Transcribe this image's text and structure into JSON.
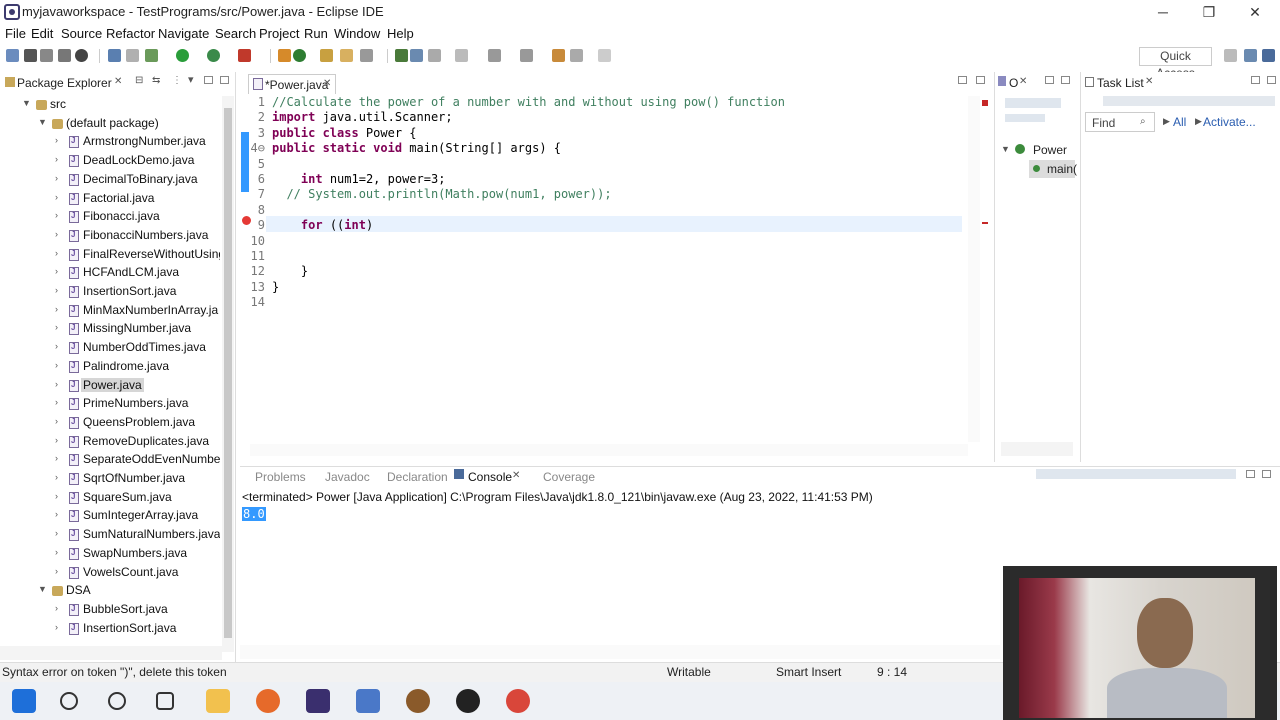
{
  "window": {
    "title": "myjavaworkspace - TestPrograms/src/Power.java - Eclipse IDE",
    "minimize_label": "─",
    "restore_label": "❐",
    "close_label": "✕"
  },
  "menu": [
    "File",
    "Edit",
    "Source",
    "Refactor",
    "Navigate",
    "Search",
    "Project",
    "Run",
    "Window",
    "Help"
  ],
  "toolbar": {
    "quick_access_placeholder": "Quick Access"
  },
  "package_explorer": {
    "title": "Package Explorer",
    "items": [
      {
        "label": "src",
        "kind": "folder",
        "indent": 1,
        "twisty": "▼"
      },
      {
        "label": "(default package)",
        "kind": "package",
        "indent": 2,
        "twisty": "▼"
      },
      {
        "label": "ArmstrongNumber.java",
        "kind": "file",
        "indent": 3,
        "twisty": "›"
      },
      {
        "label": "DeadLockDemo.java",
        "kind": "file",
        "indent": 3,
        "twisty": "›"
      },
      {
        "label": "DecimalToBinary.java",
        "kind": "file",
        "indent": 3,
        "twisty": "›"
      },
      {
        "label": "Factorial.java",
        "kind": "file",
        "indent": 3,
        "twisty": "›"
      },
      {
        "label": "Fibonacci.java",
        "kind": "file",
        "indent": 3,
        "twisty": "›"
      },
      {
        "label": "FibonacciNumbers.java",
        "kind": "file",
        "indent": 3,
        "twisty": "›"
      },
      {
        "label": "FinalReverseWithoutUsing",
        "kind": "file",
        "indent": 3,
        "twisty": "›"
      },
      {
        "label": "HCFAndLCM.java",
        "kind": "file",
        "indent": 3,
        "twisty": "›"
      },
      {
        "label": "InsertionSort.java",
        "kind": "file",
        "indent": 3,
        "twisty": "›"
      },
      {
        "label": "MinMaxNumberInArray.ja",
        "kind": "file",
        "indent": 3,
        "twisty": "›"
      },
      {
        "label": "MissingNumber.java",
        "kind": "file",
        "indent": 3,
        "twisty": "›"
      },
      {
        "label": "NumberOddTimes.java",
        "kind": "file",
        "indent": 3,
        "twisty": "›"
      },
      {
        "label": "Palindrome.java",
        "kind": "file",
        "indent": 3,
        "twisty": "›"
      },
      {
        "label": "Power.java",
        "kind": "file",
        "indent": 3,
        "twisty": "›",
        "selected": true
      },
      {
        "label": "PrimeNumbers.java",
        "kind": "file",
        "indent": 3,
        "twisty": "›"
      },
      {
        "label": "QueensProblem.java",
        "kind": "file",
        "indent": 3,
        "twisty": "›"
      },
      {
        "label": "RemoveDuplicates.java",
        "kind": "file",
        "indent": 3,
        "twisty": "›"
      },
      {
        "label": "SeparateOddEvenNumbe",
        "kind": "file",
        "indent": 3,
        "twisty": "›"
      },
      {
        "label": "SqrtOfNumber.java",
        "kind": "file",
        "indent": 3,
        "twisty": "›"
      },
      {
        "label": "SquareSum.java",
        "kind": "file",
        "indent": 3,
        "twisty": "›"
      },
      {
        "label": "SumIntegerArray.java",
        "kind": "file",
        "indent": 3,
        "twisty": "›"
      },
      {
        "label": "SumNaturalNumbers.java",
        "kind": "file",
        "indent": 3,
        "twisty": "›"
      },
      {
        "label": "SwapNumbers.java",
        "kind": "file",
        "indent": 3,
        "twisty": "›"
      },
      {
        "label": "VowelsCount.java",
        "kind": "file",
        "indent": 3,
        "twisty": "›"
      },
      {
        "label": "DSA",
        "kind": "package",
        "indent": 2,
        "twisty": "▼"
      },
      {
        "label": "BubbleSort.java",
        "kind": "file",
        "indent": 3,
        "twisty": "›"
      },
      {
        "label": "InsertionSort.java",
        "kind": "file",
        "indent": 3,
        "twisty": "›"
      }
    ]
  },
  "editor": {
    "tab_label": "*Power.java",
    "lines": [
      {
        "n": "1",
        "html": "<span class=\"cm\">//Calculate the power of a number with and without using pow() function</span>"
      },
      {
        "n": "2",
        "html": "<span class=\"kw\">import</span> java.util.Scanner;"
      },
      {
        "n": "3",
        "html": "<span class=\"kw\">public class</span> Power {"
      },
      {
        "n": "4⊖",
        "html": "<span class=\"kw\">public static void</span> main(String[] args) {"
      },
      {
        "n": "5",
        "html": ""
      },
      {
        "n": "6",
        "html": "    <span class=\"kw\">int</span> num1=2, power=3;"
      },
      {
        "n": "7",
        "html": "  <span class=\"cm\">// System.out.println(Math.pow(num1, power));</span>"
      },
      {
        "n": "8",
        "html": ""
      },
      {
        "n": "9",
        "html": "    <span class=\"kw\">for</span> ((<span class=\"kw\">int</span>)"
      },
      {
        "n": "10",
        "html": ""
      },
      {
        "n": "11",
        "html": ""
      },
      {
        "n": "12",
        "html": "    }"
      },
      {
        "n": "13",
        "html": "}"
      },
      {
        "n": "14",
        "html": ""
      }
    ]
  },
  "outline": {
    "tab_label": "O",
    "root": "Power",
    "child": "main("
  },
  "task_list": {
    "title": "Task List",
    "find_placeholder": "Find",
    "all_label": "All",
    "activate_label": "Activate..."
  },
  "console": {
    "tabs": [
      "Problems",
      "Javadoc",
      "Declaration",
      "Console",
      "Coverage"
    ],
    "active_tab": "Console",
    "terminated": "<terminated> Power [Java Application] C:\\Program Files\\Java\\jdk1.8.0_121\\bin\\javaw.exe (Aug 23, 2022, 11:41:53 PM)",
    "output": "8.0"
  },
  "status": {
    "message": "Syntax error on token \")\", delete this token",
    "writable": "Writable",
    "insert_mode": "Smart Insert",
    "position": "9 : 14"
  },
  "colors": {
    "keyword": "#7f0055",
    "comment": "#3f7f5f",
    "line_number": "#787878",
    "selection": "#3399ff"
  },
  "taskbar_icons": [
    "windows-start",
    "search",
    "cortana",
    "task-view",
    "file-explorer",
    "firefox",
    "eclipse-ide",
    "app-blue",
    "app-brown",
    "app-github",
    "chrome"
  ]
}
